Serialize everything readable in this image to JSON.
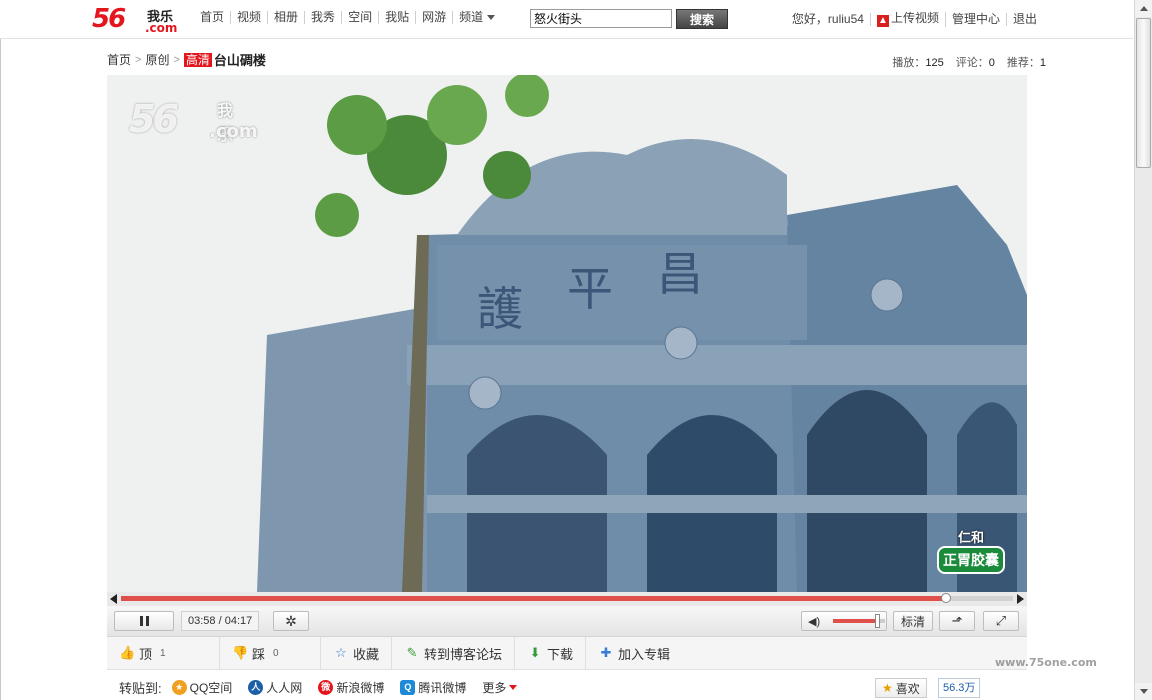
{
  "logo": {
    "num": "56",
    "wl": "我乐",
    "com": ".com"
  },
  "nav": {
    "items": [
      "首页",
      "视频",
      "相册",
      "我秀",
      "空间",
      "我贴",
      "网游"
    ],
    "more": "频道"
  },
  "search": {
    "value": "怒火街头",
    "button": "搜索"
  },
  "user": {
    "greeting": "您好，ruliu54",
    "upload": "上传视频",
    "manage": "管理中心",
    "logout": "退出"
  },
  "breadcrumb": {
    "home": "首页",
    "original": "原创",
    "hd_badge": "高清",
    "title": "台山碉楼"
  },
  "stats": {
    "play_label": "播放：",
    "play": "125",
    "comment_label": "评论：",
    "comment": "0",
    "recommend_label": "推荐：",
    "recommend": "1"
  },
  "video": {
    "watermark_num": "56",
    "watermark_wl": "我乐",
    "watermark_com": ".com",
    "ad_brand": "仁和",
    "ad_product": "正胃胶囊",
    "sky_color": "#eef1f0",
    "stone_color": "#6f8ca8"
  },
  "player": {
    "current": "03:58",
    "separator": " / ",
    "duration": "04:17",
    "progress": 0.925,
    "volume": 0.85,
    "quality": "标清",
    "accent": "#e0504a"
  },
  "actions": {
    "up_label": "顶",
    "up_count": "1",
    "down_label": "踩",
    "down_count": "0",
    "fav": "收藏",
    "blog": "转到博客论坛",
    "download": "下载",
    "album": "加入专辑"
  },
  "share": {
    "label": "转贴到:",
    "targets": [
      "QQ空间",
      "人人网",
      "新浪微博",
      "腾讯微博"
    ],
    "more": "更多",
    "like": "喜欢",
    "like_count": "56.3万"
  },
  "site_watermark": "www.75one.com"
}
